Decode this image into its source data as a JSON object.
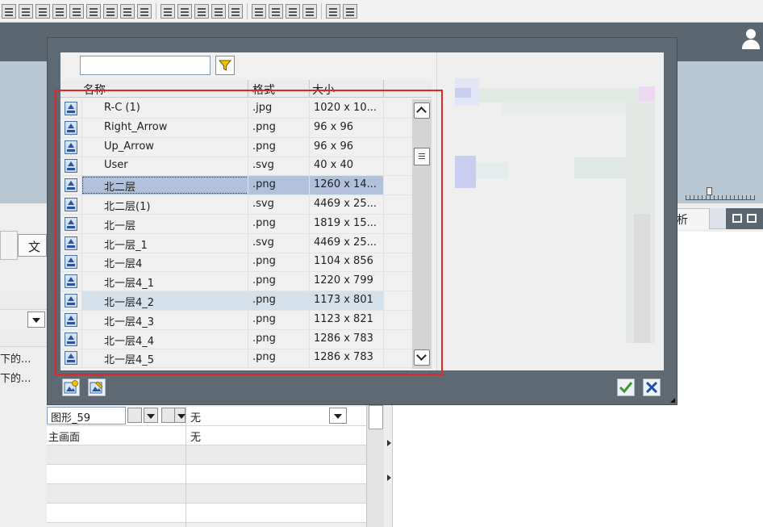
{
  "left_panel": {
    "tab_label": "文",
    "text_1": "下的...",
    "text_2": "下的..."
  },
  "properties": {
    "graphic_field_value": "图形_59",
    "row1_value": "无",
    "row2_name": "主画面",
    "row2_value": "无"
  },
  "right_panel": {
    "tab_label": "析"
  },
  "dialog": {
    "search": {
      "value": "",
      "placeholder": ""
    },
    "columns": {
      "name": "名称",
      "format": "格式",
      "size": "大小"
    },
    "rows": [
      {
        "name": "R-C (1)",
        "format": ".jpg",
        "size": "1020 x 10..."
      },
      {
        "name": "Right_Arrow",
        "format": ".png",
        "size": "96 x 96"
      },
      {
        "name": "Up_Arrow",
        "format": ".png",
        "size": "96 x 96"
      },
      {
        "name": "User",
        "format": ".svg",
        "size": "40 x 40"
      },
      {
        "name": "北二层",
        "format": ".png",
        "size": "1260 x 14..."
      },
      {
        "name": "北二层(1)",
        "format": ".svg",
        "size": "4469 x 25..."
      },
      {
        "name": "北一层",
        "format": ".png",
        "size": "1819 x 15..."
      },
      {
        "name": "北一层_1",
        "format": ".svg",
        "size": "4469 x 25..."
      },
      {
        "name": "北一层4",
        "format": ".png",
        "size": "1104 x 856"
      },
      {
        "name": "北一层4_1",
        "format": ".png",
        "size": "1220 x 799"
      },
      {
        "name": "北一层4_2",
        "format": ".png",
        "size": "1173 x 801"
      },
      {
        "name": "北一层4_3",
        "format": ".png",
        "size": "1123 x 821"
      },
      {
        "name": "北一层4_4",
        "format": ".png",
        "size": "1286 x 783"
      },
      {
        "name": "北一层4_5",
        "format": ".png",
        "size": "1286 x 783"
      }
    ],
    "selected_row": "北二层",
    "hover_row": "北一层4_2"
  },
  "colors": {
    "dialog_frame": "#5d6973",
    "selection": "#b0c1d9",
    "highlight_box": "#e42525",
    "ok_check": "#3a9a2a",
    "cancel_x": "#1f4fa8"
  },
  "icons": {
    "filter": "funnel-icon",
    "row": "image-file-icon",
    "ok": "checkmark-icon",
    "cancel": "close-icon",
    "import": "import-image-icon",
    "edit": "edit-image-icon",
    "user": "user-icon"
  }
}
